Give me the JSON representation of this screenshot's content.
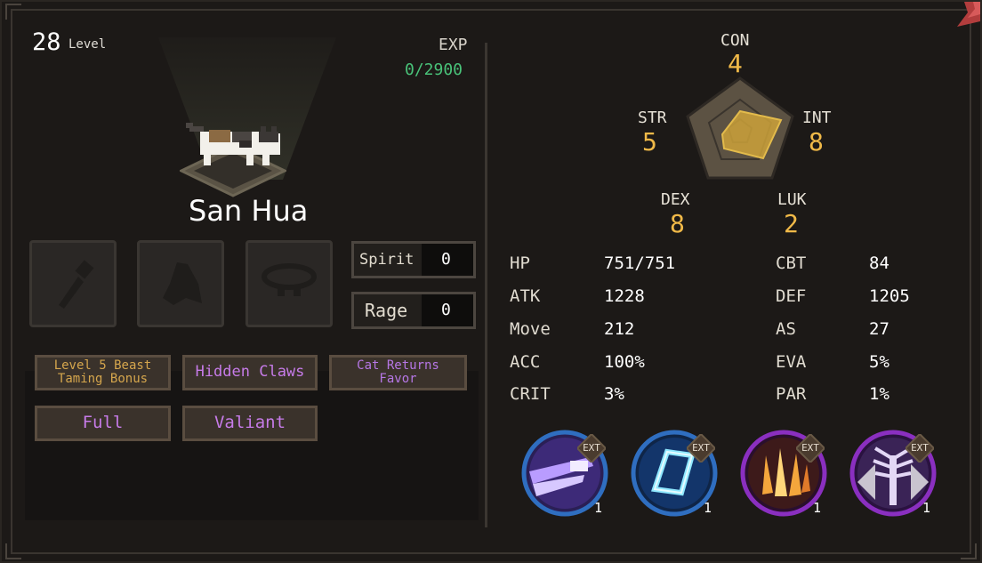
{
  "header": {
    "level": "28",
    "level_label": "Level",
    "exp_label": "EXP",
    "exp_value": "0/2900"
  },
  "pet": {
    "name": "San Hua"
  },
  "equipment_slots": [
    {
      "icon": "brush-icon"
    },
    {
      "icon": "cloak-icon"
    },
    {
      "icon": "collar-icon"
    }
  ],
  "resources": {
    "spirit_label": "Spirit",
    "spirit_value": "0",
    "rage_label": "Rage",
    "rage_value": "0"
  },
  "traits": [
    "Level 5 Beast\nTaming Bonus",
    "Hidden Claws",
    "Cat Returns\nFavor",
    "Full",
    "Valiant"
  ],
  "attributes": {
    "con_label": "CON",
    "con_value": "4",
    "str_label": "STR",
    "str_value": "5",
    "int_label": "INT",
    "int_value": "8",
    "dex_label": "DEX",
    "dex_value": "8",
    "luk_label": "LUK",
    "luk_value": "2"
  },
  "stats_left": [
    {
      "label": "HP",
      "value": "751/751"
    },
    {
      "label": "ATK",
      "value": "1228"
    },
    {
      "label": "Move",
      "value": "212"
    },
    {
      "label": "ACC",
      "value": "100%"
    },
    {
      "label": "CRIT",
      "value": "3%"
    }
  ],
  "stats_right": [
    {
      "label": "CBT",
      "value": "84"
    },
    {
      "label": "DEF",
      "value": "1205"
    },
    {
      "label": "AS",
      "value": "27"
    },
    {
      "label": "EVA",
      "value": "5%"
    },
    {
      "label": "PAR",
      "value": "1%"
    }
  ],
  "skills": [
    {
      "badge": "EXT",
      "count": "1",
      "icon": "dash-skill-icon"
    },
    {
      "badge": "EXT",
      "count": "1",
      "icon": "rune-skill-icon"
    },
    {
      "badge": "EXT",
      "count": "1",
      "icon": "flame-claw-skill-icon"
    },
    {
      "badge": "EXT",
      "count": "1",
      "icon": "spirit-tree-skill-icon"
    }
  ],
  "colors": {
    "accent_gold": "#f0b948",
    "exp_green": "#49c279",
    "trait_purple": "#c67be8",
    "trait_gold": "#d5a64d"
  }
}
